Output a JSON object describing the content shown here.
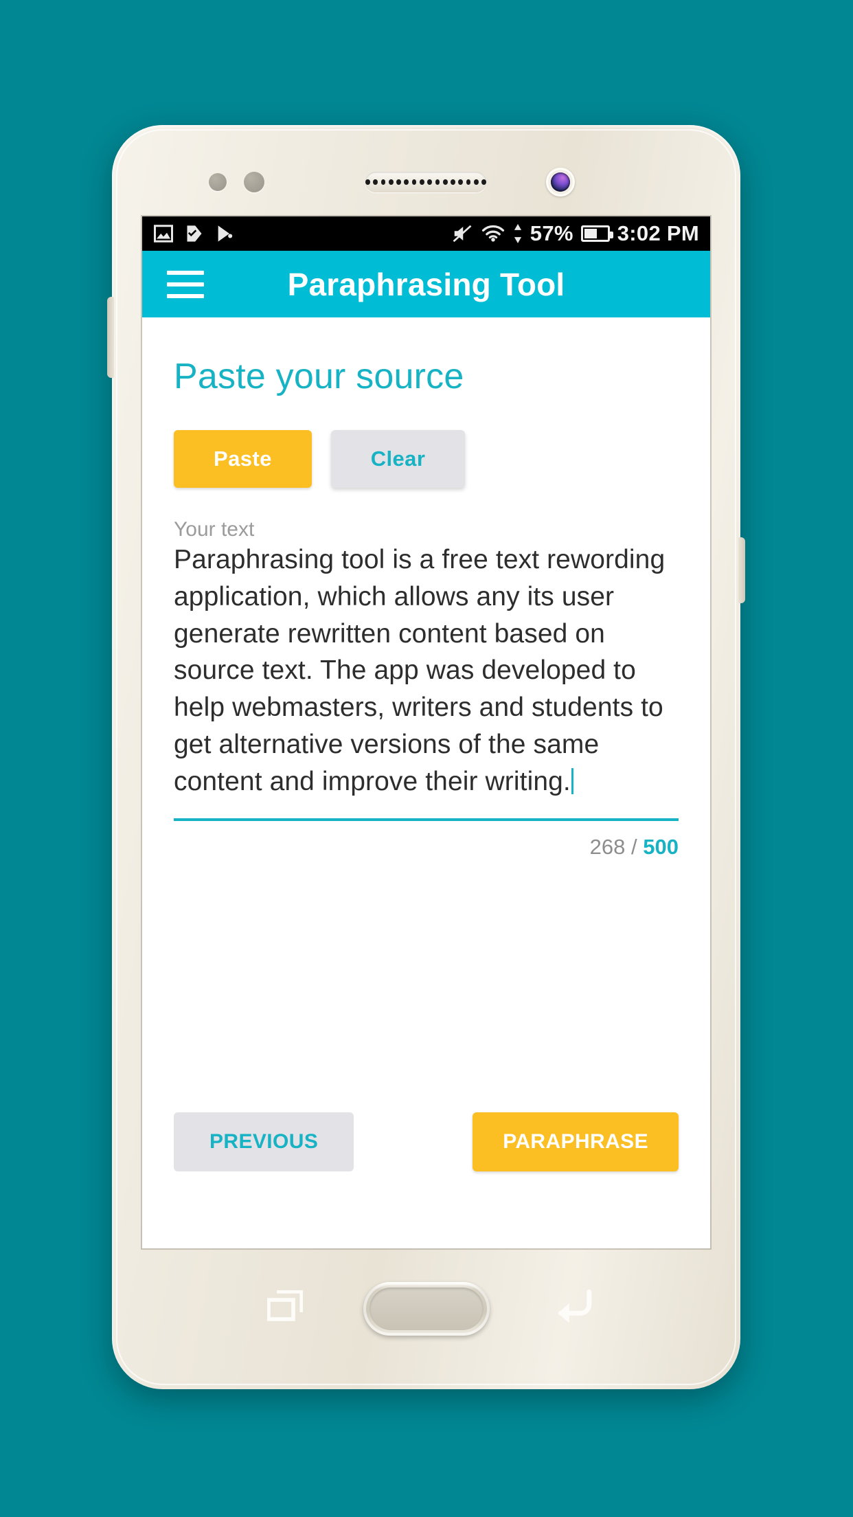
{
  "background_color": "#008793",
  "status_bar": {
    "left_icons": [
      "photos-icon",
      "task-check-icon",
      "play-store-icon"
    ],
    "right_icons": [
      "mute-icon",
      "wifi-icon",
      "data-transfer-icon"
    ],
    "battery_percent": "57%",
    "battery_level": 57,
    "clock": "3:02 PM"
  },
  "app_bar": {
    "menu_icon": "hamburger-menu-icon",
    "title": "Paraphrasing Tool",
    "background_color": "#00BCD4"
  },
  "content": {
    "page_title": "Paste your source",
    "paste_button": "Paste",
    "clear_button": "Clear",
    "textfield_label": "Your text",
    "textarea_value": "Paraphrasing tool is a free text rewording application, which allows any its user generate rewritten content based on source text. The app was developed to help webmasters, writers and students to get alternative versions of the same content and improve their writing.",
    "char_count": "268",
    "char_separator": "/",
    "char_max": "500",
    "previous_button": "PREVIOUS",
    "paraphrase_button": "PARAPHRASE",
    "accent_color": "#17b3c4",
    "amber_color": "#FBBF24",
    "grey_button_color": "#e3e2e7"
  },
  "device": {
    "earpiece": "earpiece-speaker",
    "front_camera": "front-camera",
    "recents_icon": "recents-icon",
    "home_button": "home-button",
    "back_icon": "back-icon"
  }
}
